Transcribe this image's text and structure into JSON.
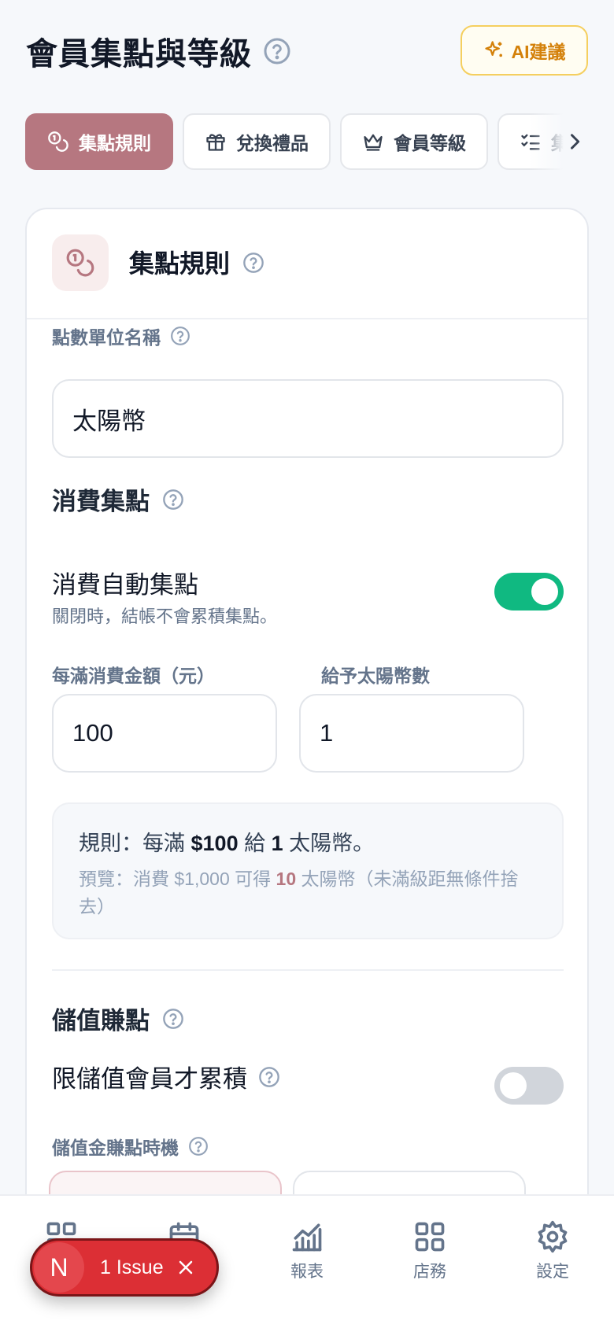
{
  "header": {
    "title": "會員集點與等級",
    "ai_button": "AI建議"
  },
  "tabs": [
    {
      "label": "集點規則",
      "active": true
    },
    {
      "label": "兌換禮品",
      "active": false
    },
    {
      "label": "會員等級",
      "active": false
    },
    {
      "label": "集",
      "active": false
    }
  ],
  "card": {
    "title": "集點規則",
    "unit_name": {
      "label": "點數單位名稱",
      "value": "太陽幣"
    },
    "spend": {
      "section_title": "消費集點",
      "auto_title": "消費自動集點",
      "auto_sub": "關閉時，結帳不會累積集點。",
      "auto_enabled": true,
      "amount_label": "每滿消費金額（元）",
      "amount_value": "100",
      "points_label": "給予太陽幣數",
      "points_value": "1",
      "rule_prefix": "規則：每滿",
      "rule_amount": "$100",
      "rule_mid": "給",
      "rule_points": "1",
      "rule_suffix": "太陽幣。",
      "preview_prefix": "預覽：消費 $1,000 可得",
      "preview_points": "10",
      "preview_suffix": "太陽幣（未滿級距無條件捨去）"
    },
    "stored_value": {
      "section_title": "儲值賺點",
      "members_only_title": "限儲值會員才累積",
      "members_only_enabled": false,
      "timing_label": "儲值金賺點時機"
    }
  },
  "bottom_nav": [
    {
      "label": "",
      "icon": "dashboard-icon"
    },
    {
      "label": "",
      "icon": "calendar-icon"
    },
    {
      "label": "報表",
      "icon": "chart-icon"
    },
    {
      "label": "店務",
      "icon": "grid-icon"
    },
    {
      "label": "設定",
      "icon": "gear-icon"
    }
  ],
  "issue_badge": {
    "letter": "N",
    "text": "1 Issue"
  },
  "colors": {
    "accent": "#b67780",
    "toggle_on": "#10b981",
    "ai": "#d4810a",
    "issue": "#dc2f35"
  }
}
